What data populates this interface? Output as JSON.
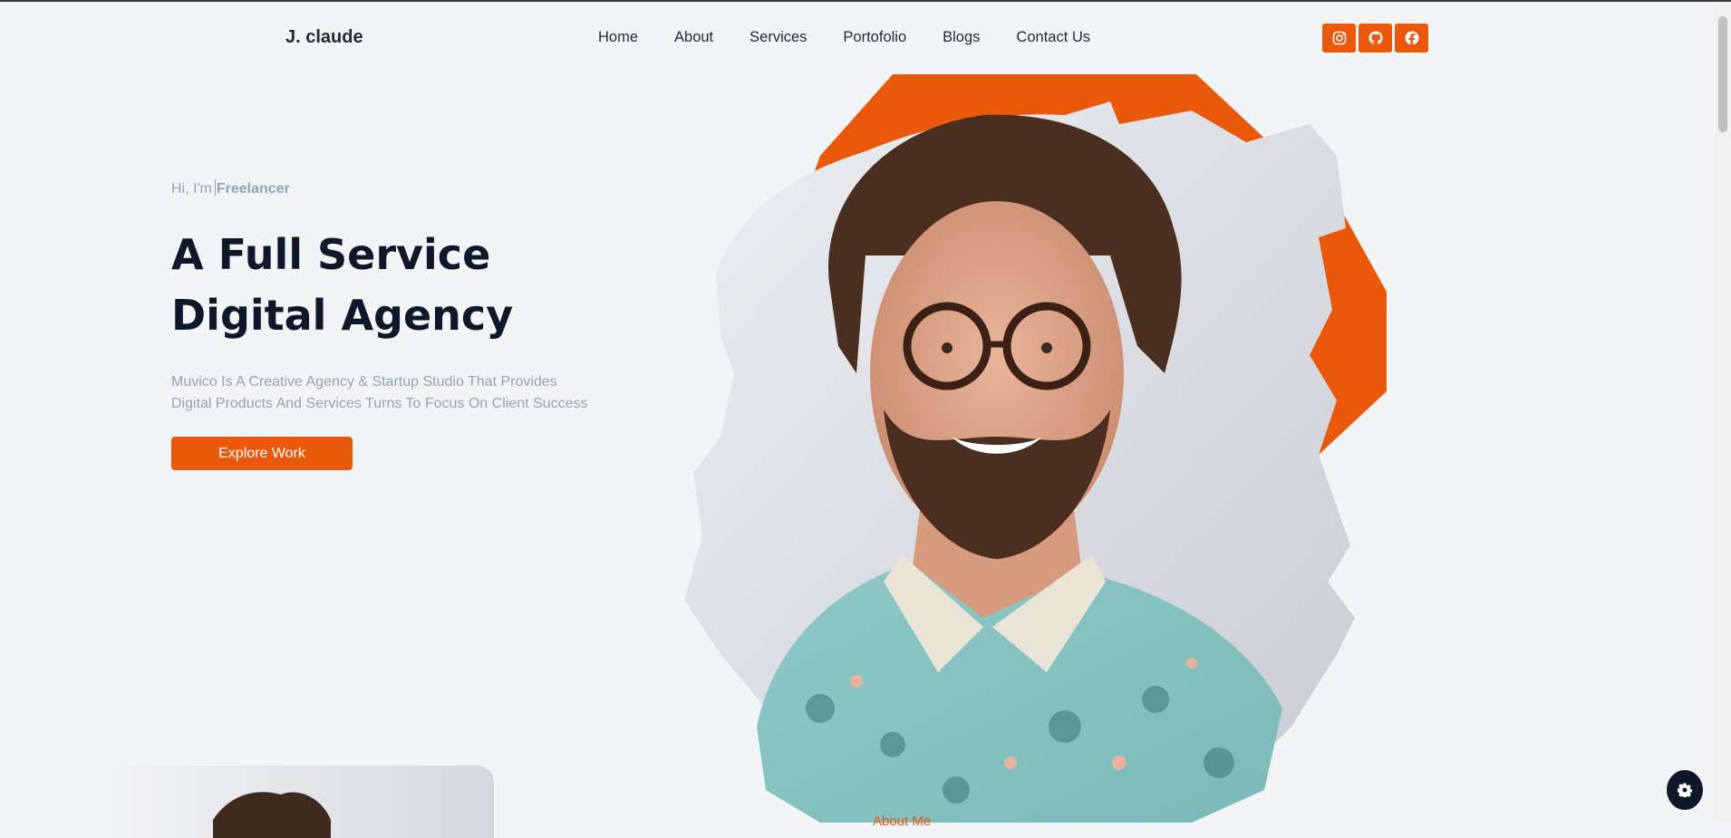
{
  "brand": "J. claude",
  "nav": [
    "Home",
    "About",
    "Services",
    "Portofolio",
    "Blogs",
    "Contact Us"
  ],
  "socials": [
    "instagram-icon",
    "github-icon",
    "facebook-icon"
  ],
  "hero": {
    "greeting_prefix": "Hi, I'm",
    "greeting_role": "Freelancer",
    "title_line1": "A Full Service",
    "title_line2": "Digital Agency",
    "desc_line1": "Muvico Is A Creative Agency & Startup Studio That Provides",
    "desc_line2": "Digital Products And Services Turns To Focus On Client Success",
    "cta": "Explore Work"
  },
  "about_label": "About Me",
  "colors": {
    "accent": "#ea580c",
    "dark": "#0f172a",
    "muted": "#94a3b8",
    "bg": "#f3f4f6"
  },
  "icons": {
    "settings": "gear-icon"
  }
}
